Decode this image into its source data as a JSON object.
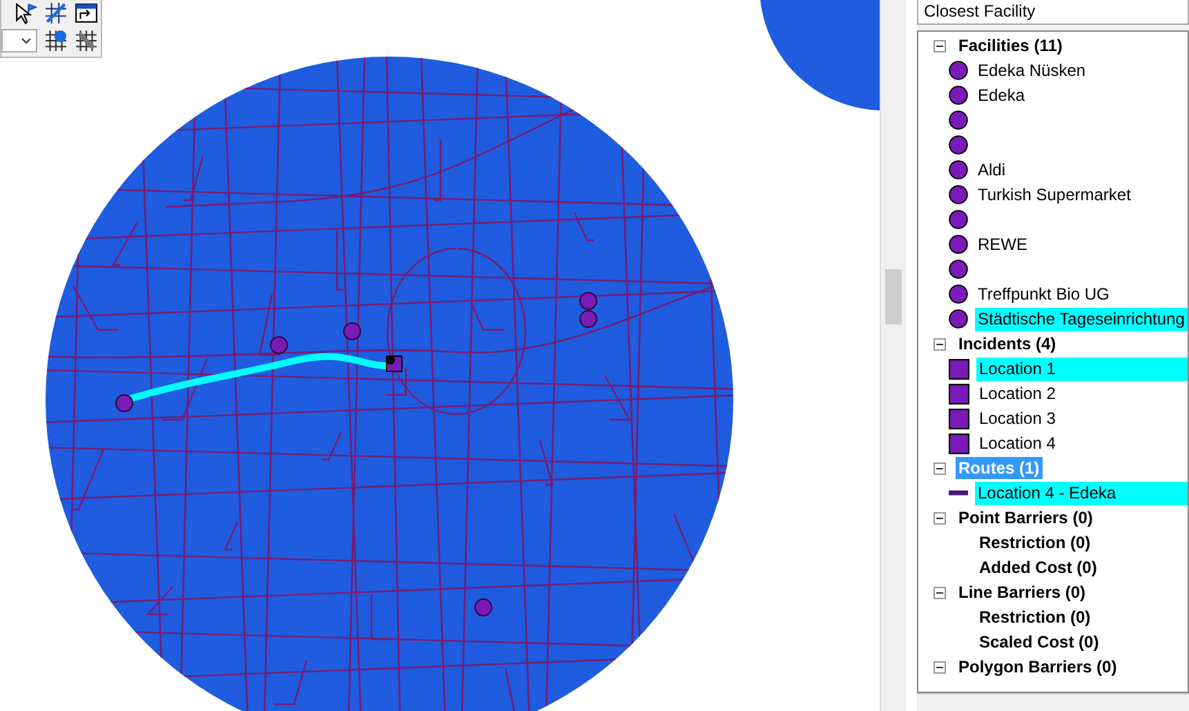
{
  "panel": {
    "title": "Closest Facility",
    "groups": [
      {
        "label": "Facilities (11)",
        "expanded": true,
        "selected": false,
        "items": [
          {
            "kind": "point",
            "selected": false,
            "label": "Edeka Nüsken"
          },
          {
            "kind": "point",
            "selected": false,
            "label": "Edeka"
          },
          {
            "kind": "point",
            "selected": false
          },
          {
            "kind": "point",
            "selected": false
          },
          {
            "kind": "point",
            "selected": false,
            "label": "Aldi"
          },
          {
            "kind": "point",
            "selected": false,
            "label": "Turkish Supermarket"
          },
          {
            "kind": "point",
            "selected": false
          },
          {
            "kind": "point",
            "selected": false,
            "label": "REWE"
          },
          {
            "kind": "point",
            "selected": false
          },
          {
            "kind": "point",
            "selected": false,
            "label": "Treffpunkt Bio UG"
          },
          {
            "kind": "point",
            "selected": true,
            "label": "Städtische Tageseinrichtung"
          }
        ]
      },
      {
        "label": "Incidents (4)",
        "expanded": true,
        "selected": false,
        "items": [
          {
            "kind": "square",
            "selected": true,
            "label": "Location 1"
          },
          {
            "kind": "square",
            "selected": false,
            "label": "Location 2"
          },
          {
            "kind": "square",
            "selected": false,
            "label": "Location 3"
          },
          {
            "kind": "square",
            "selected": false,
            "label": "Location 4"
          }
        ]
      },
      {
        "label": "Routes (1)",
        "expanded": true,
        "selected": true,
        "items": [
          {
            "kind": "line",
            "selected": true,
            "label": "Location 4 - Edeka"
          }
        ]
      },
      {
        "label": "Point Barriers (0)",
        "expanded": true,
        "selected": false,
        "items": [
          {
            "kind": "class",
            "label": "Restriction (0)"
          },
          {
            "kind": "class",
            "label": "Added Cost (0)"
          }
        ]
      },
      {
        "label": "Line Barriers (0)",
        "expanded": true,
        "selected": false,
        "items": [
          {
            "kind": "class",
            "label": "Restriction (0)"
          },
          {
            "kind": "class",
            "label": "Scaled Cost (0)"
          }
        ]
      },
      {
        "label": "Polygon Barriers (0)",
        "expanded": true,
        "selected": false
      }
    ]
  }
}
